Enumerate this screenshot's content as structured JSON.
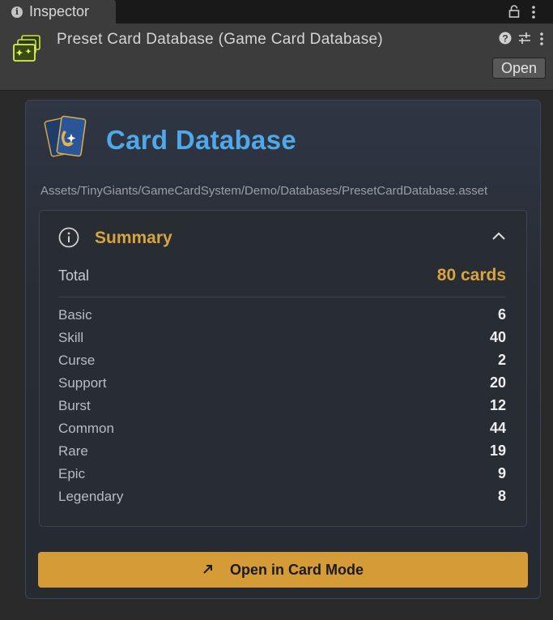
{
  "tab": {
    "label": "Inspector"
  },
  "header": {
    "title": "Preset Card Database (Game Card Database)",
    "open_label": "Open"
  },
  "card": {
    "title": "Card Database",
    "asset_path": "Assets/TinyGiants/GameCardSystem/Demo/Databases/PresetCardDatabase.asset"
  },
  "summary": {
    "title": "Summary",
    "total_label": "Total",
    "total_value": "80 cards",
    "rows": [
      {
        "label": "Basic",
        "value": "6"
      },
      {
        "label": "Skill",
        "value": "40"
      },
      {
        "label": "Curse",
        "value": "2"
      },
      {
        "label": "Support",
        "value": "20"
      },
      {
        "label": "Burst",
        "value": "12"
      },
      {
        "label": "Common",
        "value": "44"
      },
      {
        "label": "Rare",
        "value": "19"
      },
      {
        "label": "Epic",
        "value": "9"
      },
      {
        "label": "Legendary",
        "value": "8"
      }
    ]
  },
  "actions": {
    "open_card_mode_label": "Open in Card Mode"
  },
  "colors": {
    "accent_gold": "#d9a43e",
    "title_blue": "#4fa8ea",
    "button_gold": "#d49b36"
  },
  "icons": [
    "info-icon",
    "lock-icon",
    "kebab-menu-icon",
    "card-database-asset-icon",
    "help-icon",
    "preset-icon",
    "card-logo-icon",
    "chevron-up-icon",
    "arrow-up-right-icon"
  ]
}
